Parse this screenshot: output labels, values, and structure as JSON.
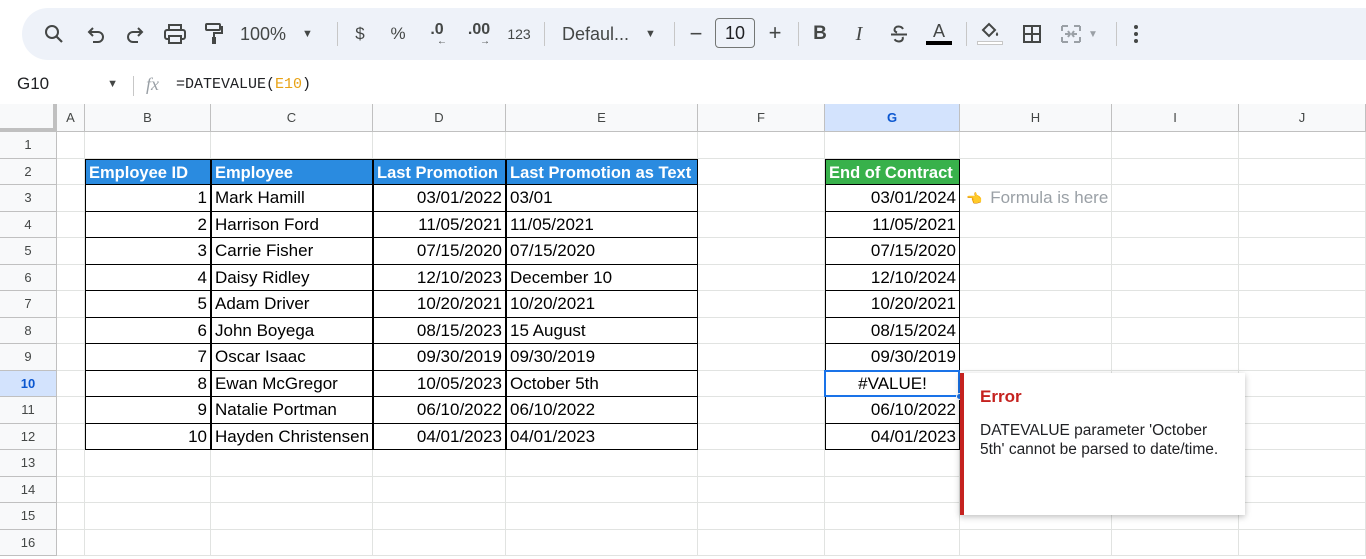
{
  "toolbar": {
    "zoom": "100%",
    "currency": "$",
    "percent": "%",
    "dec_decrease": ".0",
    "dec_increase": ".00",
    "format_123": "123",
    "font": "Defaul...",
    "font_size": "10",
    "bold": "B",
    "italic": "I",
    "text_color_glyph": "A"
  },
  "formula_bar": {
    "cell_ref": "G10",
    "fx": "fx",
    "formula_prefix": "=DATEVALUE(",
    "formula_ref": "E10",
    "formula_suffix": ")"
  },
  "columns": [
    "A",
    "B",
    "C",
    "D",
    "E",
    "F",
    "G",
    "H",
    "I",
    "J"
  ],
  "rows": [
    "1",
    "2",
    "3",
    "4",
    "5",
    "6",
    "7",
    "8",
    "9",
    "10",
    "11",
    "12",
    "13",
    "14",
    "15",
    "16"
  ],
  "selected_column": "G",
  "selected_row": "10",
  "table": {
    "headers": [
      "Employee ID",
      "Employee",
      "Last Promotion",
      "Last Promotion as Text"
    ],
    "rows": [
      [
        "1",
        "Mark Hamill",
        "03/01/2022",
        "03/01"
      ],
      [
        "2",
        "Harrison Ford",
        "11/05/2021",
        "11/05/2021"
      ],
      [
        "3",
        "Carrie Fisher",
        "07/15/2020",
        "07/15/2020"
      ],
      [
        "4",
        "Daisy Ridley",
        "12/10/2023",
        "December 10"
      ],
      [
        "5",
        "Adam Driver",
        "10/20/2021",
        "10/20/2021"
      ],
      [
        "6",
        "John Boyega",
        "08/15/2023",
        "15 August"
      ],
      [
        "7",
        "Oscar Isaac",
        "09/30/2019",
        "09/30/2019"
      ],
      [
        "8",
        "Ewan McGregor",
        "10/05/2023",
        "October 5th"
      ],
      [
        "9",
        "Natalie Portman",
        "06/10/2022",
        "06/10/2022"
      ],
      [
        "10",
        "Hayden Christensen",
        "04/01/2023",
        "04/01/2023"
      ]
    ]
  },
  "contract": {
    "header": "End of Contract",
    "values": [
      "03/01/2024",
      "11/05/2021",
      "07/15/2020",
      "12/10/2024",
      "10/20/2021",
      "08/15/2024",
      "09/30/2019",
      "#VALUE!",
      "06/10/2022",
      "04/01/2023"
    ]
  },
  "note": {
    "icon": "pointing-hand-icon",
    "text": "Formula is here"
  },
  "error_popup": {
    "title": "Error",
    "message": "DATEVALUE parameter 'October 5th' cannot be parsed to date/time."
  },
  "colors": {
    "header_blue": "#2a8be0",
    "header_green": "#38b14b",
    "error_red": "#c5221f",
    "selection_blue": "#1a73e8"
  }
}
